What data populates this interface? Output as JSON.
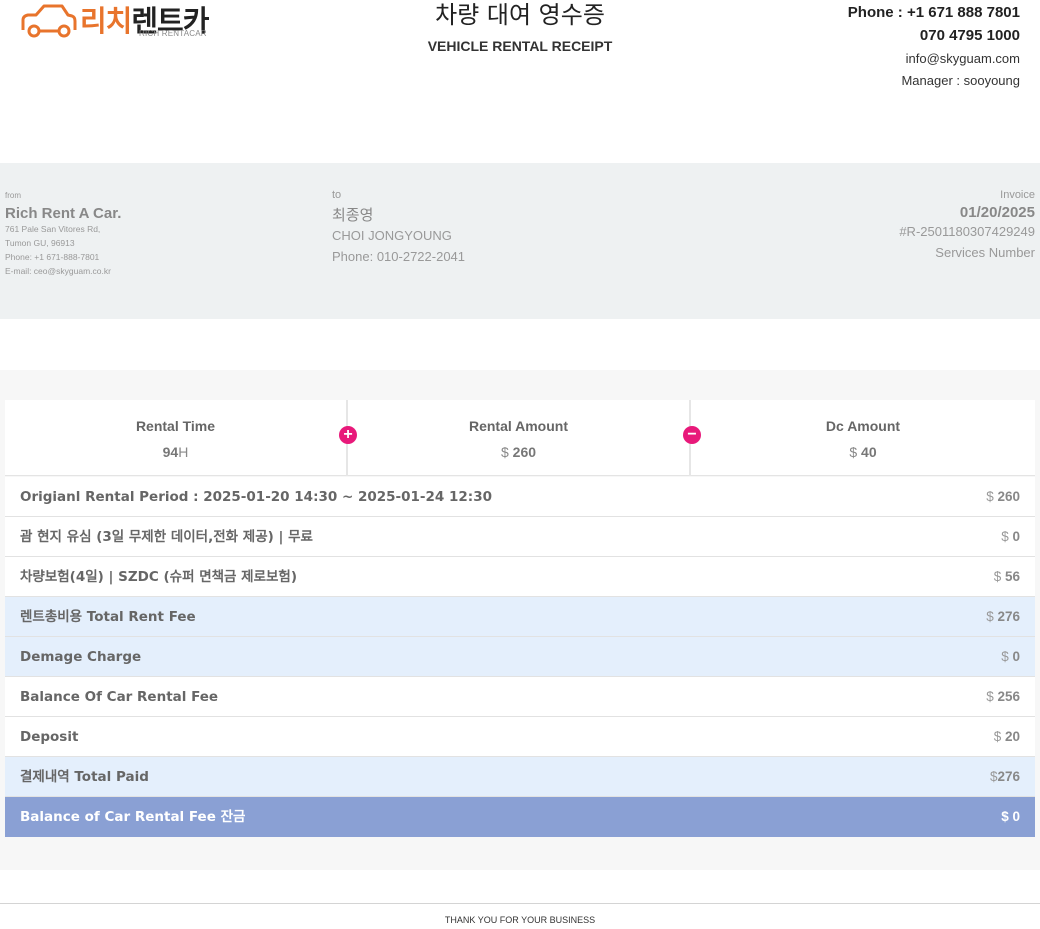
{
  "header": {
    "logo_ko_part1": "리치",
    "logo_ko_part2": "렌트카",
    "logo_sub": "RICH RENTACAR",
    "title_ko": "차량 대여 영수증",
    "title_en": "VEHICLE RENTAL RECEIPT",
    "phone": "Phone : +1 671 888 7801",
    "phone2": "070 4795 1000",
    "email": "info@skyguam.com",
    "manager": "Manager : sooyoung"
  },
  "from": {
    "label": "from",
    "name": "Rich Rent A Car.",
    "address1": "761 Pale San Vitores Rd,",
    "address2": "Tumon GU, 96913",
    "phone": "Phone: +1 671-888-7801",
    "email": "E-mail: ceo@skyguam.co.kr"
  },
  "to": {
    "label": "to",
    "name_ko": "최종영",
    "name_en": "CHOI JONGYOUNG",
    "phone": "Phone: 010-2722-2041"
  },
  "invoice": {
    "label": "Invoice",
    "date": "01/20/2025",
    "number": "#R-2501180307429249",
    "services": "Services Number"
  },
  "summary": {
    "rental_time_label": "Rental Time",
    "rental_time_value": "94",
    "rental_time_unit": "H",
    "rental_amount_label": "Rental Amount",
    "rental_amount_currency": "$",
    "rental_amount_value": "260",
    "dc_amount_label": "Dc Amount",
    "dc_amount_currency": "$",
    "dc_amount_value": "40",
    "plus_symbol": "+",
    "minus_symbol": "−"
  },
  "rows": [
    {
      "label": "Origianl Rental Period : 2025-01-20 14:30 ~ 2025-01-24 12:30",
      "currency": "$ ",
      "amount": "260"
    },
    {
      "label": "괌 현지 유심 (3일 무제한 데이터,전화 제공) | 무료",
      "currency": "$ ",
      "amount": "0"
    },
    {
      "label": "차량보험(4일) | SZDC (슈퍼 면책금 제로보험)",
      "currency": "$ ",
      "amount": "56"
    },
    {
      "label": "렌트총비용 Total Rent Fee",
      "currency": "$ ",
      "amount": "276"
    },
    {
      "label": "Demage Charge",
      "currency": "$ ",
      "amount": "0"
    },
    {
      "label": "Balance Of Car Rental Fee",
      "currency": "$ ",
      "amount": "256"
    },
    {
      "label": "Deposit",
      "currency": "$ ",
      "amount": "20"
    },
    {
      "label": "결제내역 Total Paid",
      "currency": "$",
      "amount": "276"
    },
    {
      "label": "Balance of Car Rental Fee 잔금",
      "currency": "$ ",
      "amount": "0"
    }
  ],
  "footer": "THANK YOU FOR YOUR BUSINESS",
  "colors": {
    "logo_orange": "#e8742c",
    "info_bg": "#eef1f2",
    "row_blue": "#e4effc",
    "row_dark": "#8aa0d4",
    "symbol_pink": "#e8197a"
  }
}
